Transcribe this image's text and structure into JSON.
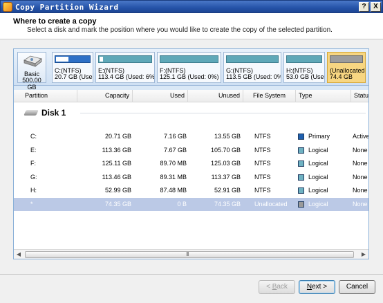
{
  "window": {
    "title": "Copy Partition Wizard",
    "help_label": "?",
    "close_label": "X"
  },
  "header": {
    "title": "Where to create a copy",
    "subtitle": "Select a disk and mark the position where you would like to create the copy of the selected partition."
  },
  "diskmap": {
    "disk_label": "Basic",
    "disk_size": "500.00 GB",
    "partitions": [
      {
        "name": "C:(NTFS)",
        "info": "20.7 GB (Usec",
        "fill": 0.35,
        "type": "primary"
      },
      {
        "name": "E:(NTFS)",
        "info": "113.4 GB (Used: 6%)",
        "fill": 0.06,
        "type": "logical"
      },
      {
        "name": "F:(NTFS)",
        "info": "125.1 GB (Used: 0%)",
        "fill": 0.0,
        "type": "logical"
      },
      {
        "name": "G:(NTFS)",
        "info": "113.5 GB (Used: 0%)",
        "fill": 0.0,
        "type": "logical"
      },
      {
        "name": "H:(NTFS)",
        "info": "53.0 GB (Used",
        "fill": 0.0,
        "type": "logical"
      },
      {
        "name": "(Unallocated",
        "info": "74.4 GB",
        "fill": 0.0,
        "type": "unallocated"
      }
    ]
  },
  "table": {
    "columns": [
      "Partition",
      "Capacity",
      "Used",
      "Unused",
      "File System",
      "Type",
      "Status"
    ],
    "group": "Disk 1",
    "rows": [
      {
        "partition": "C:",
        "capacity": "20.71 GB",
        "used": "7.16 GB",
        "unused": "13.55 GB",
        "fs": "NTFS",
        "type": "Primary",
        "status": "Active",
        "color": "#1e5fae"
      },
      {
        "partition": "E:",
        "capacity": "113.36 GB",
        "used": "7.67 GB",
        "unused": "105.70 GB",
        "fs": "NTFS",
        "type": "Logical",
        "status": "None",
        "color": "#6fb2c2"
      },
      {
        "partition": "F:",
        "capacity": "125.11 GB",
        "used": "89.70 MB",
        "unused": "125.03 GB",
        "fs": "NTFS",
        "type": "Logical",
        "status": "None",
        "color": "#6fb2c2"
      },
      {
        "partition": "G:",
        "capacity": "113.46 GB",
        "used": "89.31 MB",
        "unused": "113.37 GB",
        "fs": "NTFS",
        "type": "Logical",
        "status": "None",
        "color": "#6fb2c2"
      },
      {
        "partition": "H:",
        "capacity": "52.99 GB",
        "used": "87.48 MB",
        "unused": "52.91 GB",
        "fs": "NTFS",
        "type": "Logical",
        "status": "None",
        "color": "#6fb2c2"
      },
      {
        "partition": "*",
        "capacity": "74.35 GB",
        "used": "0 B",
        "unused": "74.35 GB",
        "fs": "Unallocated",
        "type": "Logical",
        "status": "None",
        "color": "#9a9a9a",
        "selected": true
      }
    ]
  },
  "scrollbar": {
    "grip": "III"
  },
  "buttons": {
    "back": "Back",
    "back_mnemonic": "B",
    "next": "Next",
    "next_mnemonic": "N",
    "cancel": "Cancel"
  }
}
